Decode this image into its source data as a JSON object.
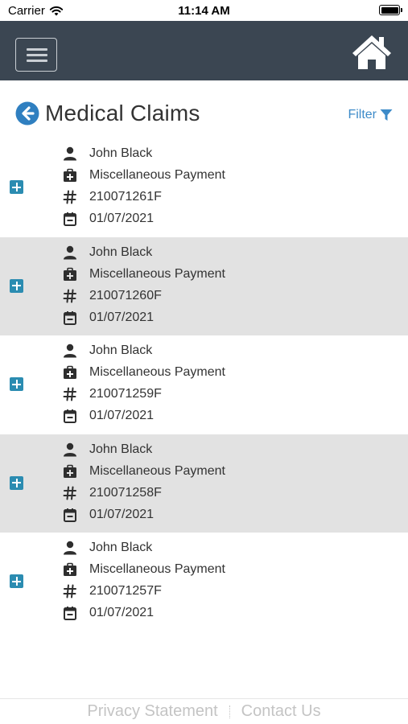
{
  "status_bar": {
    "carrier": "Carrier",
    "time": "11:14 AM"
  },
  "header": {
    "menu_icon": "hamburger-icon",
    "home_icon": "home-icon"
  },
  "page": {
    "title": "Medical Claims",
    "filter_label": "Filter",
    "back_icon": "back-arrow-icon"
  },
  "claims": [
    {
      "name": "John Black",
      "type": "Miscellaneous Payment",
      "number": "210071261F",
      "date": "01/07/2021"
    },
    {
      "name": "John Black",
      "type": "Miscellaneous Payment",
      "number": "210071260F",
      "date": "01/07/2021"
    },
    {
      "name": "John Black",
      "type": "Miscellaneous Payment",
      "number": "210071259F",
      "date": "01/07/2021"
    },
    {
      "name": "John Black",
      "type": "Miscellaneous Payment",
      "number": "210071258F",
      "date": "01/07/2021"
    },
    {
      "name": "John Black",
      "type": "Miscellaneous Payment",
      "number": "210071257F",
      "date": "01/07/2021"
    }
  ],
  "footer": {
    "privacy": "Privacy Statement",
    "contact": "Contact Us"
  },
  "colors": {
    "header_bg": "#3b4652",
    "accent": "#3d8bc9",
    "expand_button": "#2b8cb1",
    "alt_row": "#e2e2e2"
  }
}
